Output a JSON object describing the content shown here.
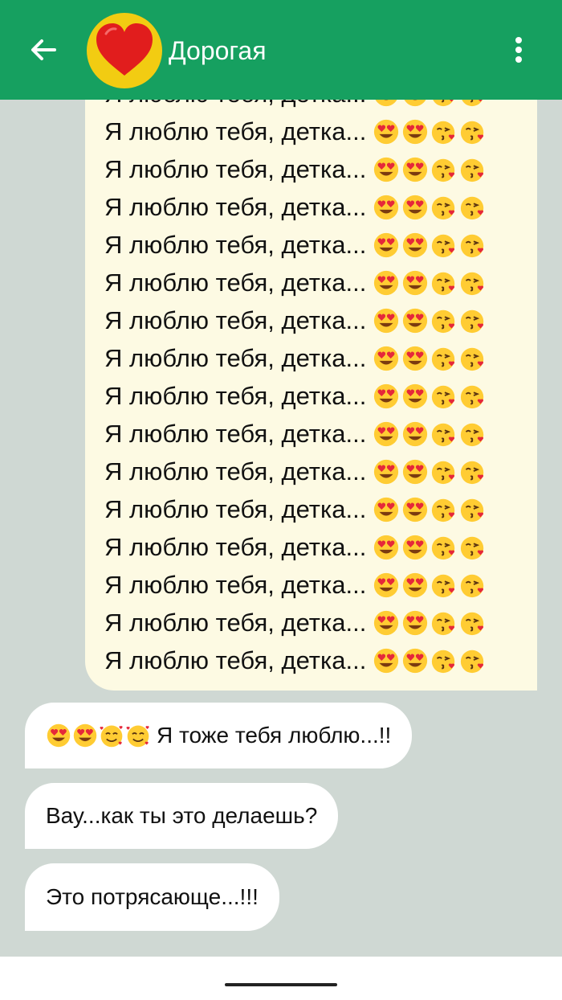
{
  "header": {
    "contact_name": "Дорогая",
    "back_icon": "arrow-left-icon",
    "menu_icon": "more-vertical-icon",
    "avatar_icon": "red-heart-icon",
    "bar_color": "#16a060",
    "avatar_bg": "#f2cc12"
  },
  "chat": {
    "background": "#cfd8d3",
    "sent_message": {
      "line_text": "Я люблю тебя, детка...",
      "line_emojis": [
        "heart-eyes-emoji",
        "heart-eyes-emoji",
        "kissing-heart-emoji",
        "kissing-heart-emoji"
      ],
      "visible_line_count": 16,
      "bubble_color": "#fdfae3"
    },
    "received_messages": [
      {
        "emojis": [
          "heart-eyes-emoji",
          "heart-eyes-emoji",
          "smiling-hearts-emoji",
          "smiling-hearts-emoji"
        ],
        "text": "Я тоже тебя люблю...!!"
      },
      {
        "emojis": [],
        "text": "Вау...как ты это делаешь?"
      },
      {
        "emojis": [],
        "text": "Это потрясающе...!!!"
      }
    ]
  }
}
